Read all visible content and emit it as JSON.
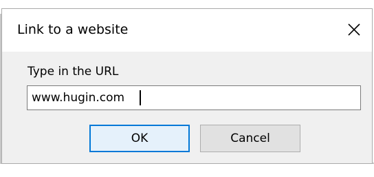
{
  "dialog": {
    "title": "Link to a website",
    "close_icon": "close-icon"
  },
  "form": {
    "prompt_label": "Type in the URL",
    "url_value": "www.hugin.com"
  },
  "buttons": {
    "ok_label": "OK",
    "cancel_label": "Cancel"
  },
  "colors": {
    "dialog_background": "#f0f0f0",
    "titlebar_background": "#ffffff",
    "default_button_border": "#0078d7",
    "default_button_fill": "#e5f1fb",
    "button_fill": "#e1e1e1"
  }
}
